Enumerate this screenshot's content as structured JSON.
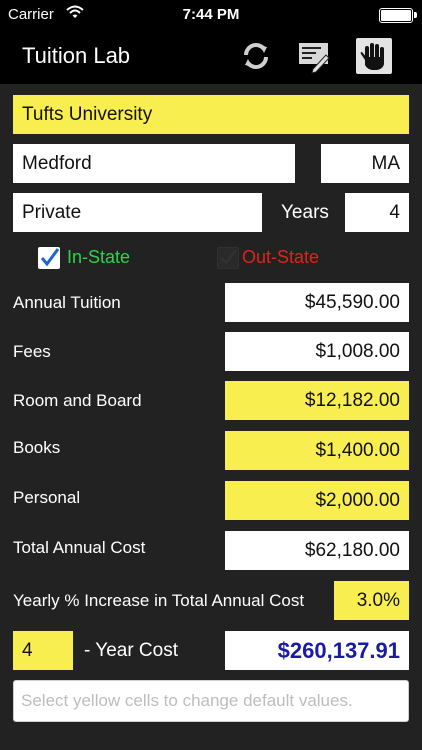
{
  "status_bar": {
    "carrier": "Carrier",
    "time": "7:44 PM"
  },
  "nav": {
    "title": "Tuition Lab",
    "icons": [
      "refresh-icon",
      "edit-form-icon",
      "hand-stop-icon"
    ]
  },
  "school": {
    "name": "Tufts University",
    "city": "Medford",
    "state": "MA",
    "type": "Private",
    "years_label": "Years",
    "years": "4"
  },
  "residency": {
    "in_state_label": "In-State",
    "out_state_label": "Out-State",
    "in_state_checked": true,
    "out_state_checked": false
  },
  "costs": {
    "annual_tuition_label": "Annual Tuition",
    "annual_tuition": "$45,590.00",
    "fees_label": "Fees",
    "fees": "$1,008.00",
    "room_board_label": "Room and Board",
    "room_board": "$12,182.00",
    "books_label": "Books",
    "books": "$1,400.00",
    "personal_label": "Personal",
    "personal": "$2,000.00",
    "total_annual_label": "Total Annual Cost",
    "total_annual": "$62,180.00",
    "yearly_increase_label": "Yearly % Increase in Total Annual Cost",
    "yearly_increase": "3.0%"
  },
  "projection": {
    "years": "4",
    "label": "- Year Cost",
    "total": "$260,137.91"
  },
  "hint": {
    "placeholder": "Select yellow cells to change default values."
  },
  "colors": {
    "background": "#222222",
    "bar": "#000000",
    "editable": "#f8ee50",
    "in_state": "#2fd24a",
    "out_state": "#e2231a",
    "total": "#1a1aa6"
  }
}
